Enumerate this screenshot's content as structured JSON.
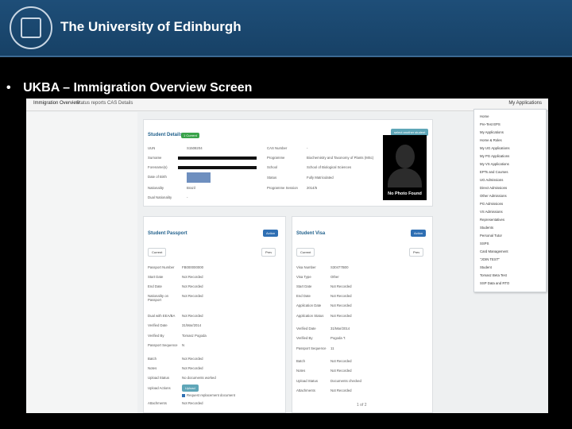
{
  "banner": {
    "title": "The University of Edinburgh",
    "crest": "edinburgh-crest"
  },
  "slide": {
    "bullet": "•",
    "title": "UKBA – Immigration Overview Screen"
  },
  "tabs": [
    "Immigration Overview",
    "Status reports",
    "CAS Details"
  ],
  "user_menu_label": "My Applications",
  "student_details": {
    "heading": "Student Details",
    "badge": "1 Current",
    "action": "select another student",
    "left": [
      {
        "label": "UUN",
        "value": "S1508204"
      },
      {
        "label": "Surname",
        "value": ""
      },
      {
        "label": "Forename(s)",
        "value": ""
      },
      {
        "label": "Date of Birth",
        "value": ""
      },
      {
        "label": "Nationality",
        "value": "Brazil"
      },
      {
        "label": "Dual Nationality",
        "value": "-"
      }
    ],
    "right": [
      {
        "label": "CAS Number",
        "value": "-"
      },
      {
        "label": "Programme",
        "value": "Biochemistry and Taxonomy of Plants (MSc)"
      },
      {
        "label": "School",
        "value": "School of Biological Sciences"
      },
      {
        "label": "Status",
        "value": "Fully Matriculated"
      },
      {
        "label": "Programme Session",
        "value": "2014/5"
      }
    ],
    "photo_text": "No Photo Found"
  },
  "passport": {
    "heading": "Student Passport",
    "action": "Action",
    "current_btn": "Current",
    "prev_btn": "Prev",
    "rows": [
      {
        "label": "Passport Number",
        "value": "FB000000000"
      },
      {
        "label": "Start Date",
        "value": "Not Recorded"
      },
      {
        "label": "End Date",
        "value": "Not Recorded"
      },
      {
        "label": "Nationality on Passport",
        "value": "Not Recorded"
      },
      {
        "label": "Dual with EEA/BA",
        "value": "Not Recorded"
      },
      {
        "label": "Verified Date",
        "value": "31/Mar/2014"
      },
      {
        "label": "Verified By",
        "value": "Tomasz Pogoda"
      },
      {
        "label": "Passport Sequence",
        "value": "N"
      },
      {
        "label": "Batch",
        "value": "Not Recorded"
      },
      {
        "label": "Notes",
        "value": "Not Recorded"
      },
      {
        "label": "Upload Status",
        "value": "No documents worked"
      },
      {
        "label": "Upload Actions",
        "value": "Upload"
      },
      {
        "label": "",
        "value": "Request replacement document"
      },
      {
        "label": "Attachments",
        "value": "Not Recorded"
      }
    ]
  },
  "visa": {
    "heading": "Student Visa",
    "action": "Action",
    "current_btn": "Current",
    "prev_btn": "Prev",
    "rows": [
      {
        "label": "Visa Number",
        "value": "S30477B00"
      },
      {
        "label": "Visa Type",
        "value": "Other"
      },
      {
        "label": "Start Date",
        "value": "Not Recorded"
      },
      {
        "label": "End Date",
        "value": "Not Recorded"
      },
      {
        "label": "Application Date",
        "value": "Not Recorded"
      },
      {
        "label": "Application Status",
        "value": "Not Recorded"
      },
      {
        "label": "Verified Date",
        "value": "31/Mar/2014"
      },
      {
        "label": "Verified By",
        "value": "Pogoda T."
      },
      {
        "label": "Passport Sequence",
        "value": "11"
      },
      {
        "label": "Batch",
        "value": "Not Recorded"
      },
      {
        "label": "Notes",
        "value": "Not Recorded"
      },
      {
        "label": "Upload Status",
        "value": "Documents checked"
      },
      {
        "label": "Attachments",
        "value": "Not Recorded"
      }
    ],
    "pager": "1 of 2"
  },
  "menu": [
    "Home",
    "Pre-Test EPS",
    "My Applications",
    "Home & Roles",
    "My UG Applications",
    "My PG Applications",
    "My VS Applications",
    "EPTs and Courses",
    "UG Admissions",
    "Direct Admissions",
    "Other Admissions",
    "PG Admissions",
    "VS Admissions",
    "Representatives",
    "Students",
    "Personal Tutor",
    "SSPS",
    "Card Management",
    "\"JOIN TEST\"",
    "Student",
    "Tomasz Beta Test",
    "SSP Data and RTO"
  ]
}
